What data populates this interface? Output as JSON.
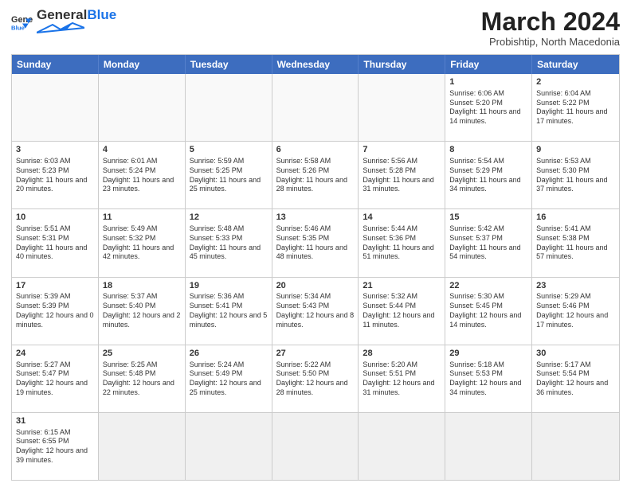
{
  "header": {
    "logo_general": "General",
    "logo_blue": "Blue",
    "month": "March 2024",
    "location": "Probishtip, North Macedonia"
  },
  "days_of_week": [
    "Sunday",
    "Monday",
    "Tuesday",
    "Wednesday",
    "Thursday",
    "Friday",
    "Saturday"
  ],
  "weeks": [
    [
      {
        "day": "",
        "info": ""
      },
      {
        "day": "",
        "info": ""
      },
      {
        "day": "",
        "info": ""
      },
      {
        "day": "",
        "info": ""
      },
      {
        "day": "",
        "info": ""
      },
      {
        "day": "1",
        "info": "Sunrise: 6:06 AM\nSunset: 5:20 PM\nDaylight: 11 hours and 14 minutes."
      },
      {
        "day": "2",
        "info": "Sunrise: 6:04 AM\nSunset: 5:22 PM\nDaylight: 11 hours and 17 minutes."
      }
    ],
    [
      {
        "day": "3",
        "info": "Sunrise: 6:03 AM\nSunset: 5:23 PM\nDaylight: 11 hours and 20 minutes."
      },
      {
        "day": "4",
        "info": "Sunrise: 6:01 AM\nSunset: 5:24 PM\nDaylight: 11 hours and 23 minutes."
      },
      {
        "day": "5",
        "info": "Sunrise: 5:59 AM\nSunset: 5:25 PM\nDaylight: 11 hours and 25 minutes."
      },
      {
        "day": "6",
        "info": "Sunrise: 5:58 AM\nSunset: 5:26 PM\nDaylight: 11 hours and 28 minutes."
      },
      {
        "day": "7",
        "info": "Sunrise: 5:56 AM\nSunset: 5:28 PM\nDaylight: 11 hours and 31 minutes."
      },
      {
        "day": "8",
        "info": "Sunrise: 5:54 AM\nSunset: 5:29 PM\nDaylight: 11 hours and 34 minutes."
      },
      {
        "day": "9",
        "info": "Sunrise: 5:53 AM\nSunset: 5:30 PM\nDaylight: 11 hours and 37 minutes."
      }
    ],
    [
      {
        "day": "10",
        "info": "Sunrise: 5:51 AM\nSunset: 5:31 PM\nDaylight: 11 hours and 40 minutes."
      },
      {
        "day": "11",
        "info": "Sunrise: 5:49 AM\nSunset: 5:32 PM\nDaylight: 11 hours and 42 minutes."
      },
      {
        "day": "12",
        "info": "Sunrise: 5:48 AM\nSunset: 5:33 PM\nDaylight: 11 hours and 45 minutes."
      },
      {
        "day": "13",
        "info": "Sunrise: 5:46 AM\nSunset: 5:35 PM\nDaylight: 11 hours and 48 minutes."
      },
      {
        "day": "14",
        "info": "Sunrise: 5:44 AM\nSunset: 5:36 PM\nDaylight: 11 hours and 51 minutes."
      },
      {
        "day": "15",
        "info": "Sunrise: 5:42 AM\nSunset: 5:37 PM\nDaylight: 11 hours and 54 minutes."
      },
      {
        "day": "16",
        "info": "Sunrise: 5:41 AM\nSunset: 5:38 PM\nDaylight: 11 hours and 57 minutes."
      }
    ],
    [
      {
        "day": "17",
        "info": "Sunrise: 5:39 AM\nSunset: 5:39 PM\nDaylight: 12 hours and 0 minutes."
      },
      {
        "day": "18",
        "info": "Sunrise: 5:37 AM\nSunset: 5:40 PM\nDaylight: 12 hours and 2 minutes."
      },
      {
        "day": "19",
        "info": "Sunrise: 5:36 AM\nSunset: 5:41 PM\nDaylight: 12 hours and 5 minutes."
      },
      {
        "day": "20",
        "info": "Sunrise: 5:34 AM\nSunset: 5:43 PM\nDaylight: 12 hours and 8 minutes."
      },
      {
        "day": "21",
        "info": "Sunrise: 5:32 AM\nSunset: 5:44 PM\nDaylight: 12 hours and 11 minutes."
      },
      {
        "day": "22",
        "info": "Sunrise: 5:30 AM\nSunset: 5:45 PM\nDaylight: 12 hours and 14 minutes."
      },
      {
        "day": "23",
        "info": "Sunrise: 5:29 AM\nSunset: 5:46 PM\nDaylight: 12 hours and 17 minutes."
      }
    ],
    [
      {
        "day": "24",
        "info": "Sunrise: 5:27 AM\nSunset: 5:47 PM\nDaylight: 12 hours and 19 minutes."
      },
      {
        "day": "25",
        "info": "Sunrise: 5:25 AM\nSunset: 5:48 PM\nDaylight: 12 hours and 22 minutes."
      },
      {
        "day": "26",
        "info": "Sunrise: 5:24 AM\nSunset: 5:49 PM\nDaylight: 12 hours and 25 minutes."
      },
      {
        "day": "27",
        "info": "Sunrise: 5:22 AM\nSunset: 5:50 PM\nDaylight: 12 hours and 28 minutes."
      },
      {
        "day": "28",
        "info": "Sunrise: 5:20 AM\nSunset: 5:51 PM\nDaylight: 12 hours and 31 minutes."
      },
      {
        "day": "29",
        "info": "Sunrise: 5:18 AM\nSunset: 5:53 PM\nDaylight: 12 hours and 34 minutes."
      },
      {
        "day": "30",
        "info": "Sunrise: 5:17 AM\nSunset: 5:54 PM\nDaylight: 12 hours and 36 minutes."
      }
    ],
    [
      {
        "day": "31",
        "info": "Sunrise: 6:15 AM\nSunset: 6:55 PM\nDaylight: 12 hours and 39 minutes."
      },
      {
        "day": "",
        "info": ""
      },
      {
        "day": "",
        "info": ""
      },
      {
        "day": "",
        "info": ""
      },
      {
        "day": "",
        "info": ""
      },
      {
        "day": "",
        "info": ""
      },
      {
        "day": "",
        "info": ""
      }
    ]
  ]
}
